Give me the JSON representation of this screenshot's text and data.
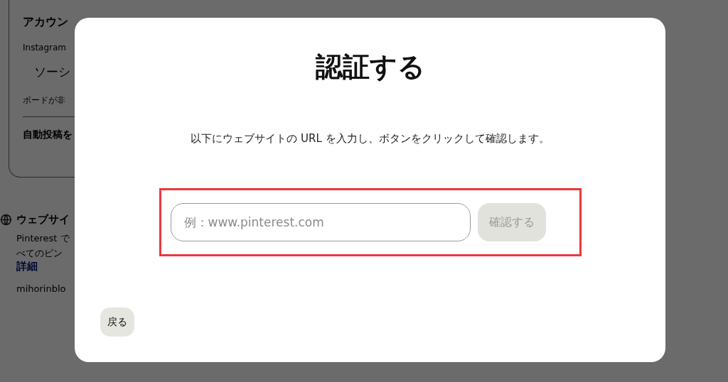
{
  "background": {
    "account_card": {
      "title": "アカウン",
      "instagram_label": "Instagram",
      "social_item": "ソーシ",
      "board_note": "ボードが非",
      "auto_post": "自動投稿を"
    },
    "website_section": {
      "title": "ウェブサイ",
      "text_line_1": "Pinterest で",
      "text_line_2": "べてのピン",
      "link": "詳細",
      "domain": "mihorinblo"
    }
  },
  "modal": {
    "title": "認証する",
    "description": "以下にウェブサイトの URL を入力し、ボタンをクリックして確認します。",
    "url_field": {
      "placeholder": "例：www.pinterest.com"
    },
    "confirm_button": {
      "label": "確認する",
      "disabled": true
    },
    "back_button": "戻る"
  }
}
